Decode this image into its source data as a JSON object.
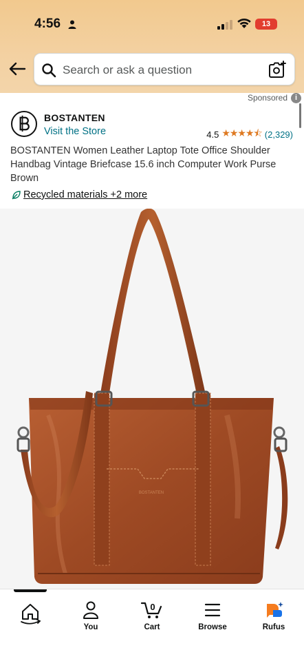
{
  "status_bar": {
    "time": "4:56",
    "battery": "13"
  },
  "search": {
    "placeholder": "Search or ask a question"
  },
  "sponsored_label": "Sponsored",
  "brand": {
    "name": "BOSTANTEN",
    "store_link": "Visit the Store",
    "rating": "4.5",
    "stars": "★★★★⯪",
    "review_count": "(2,329)"
  },
  "product": {
    "title": "BOSTANTEN Women Leather Laptop Tote Office Shoulder Handbag Vintage Briefcase 15.6 inch Computer Work Purse Brown",
    "recycled": "Recycled materials +2 more",
    "image_alt": "BOSTANTEN brown leather tote bag"
  },
  "bottom_nav": {
    "items": [
      {
        "label": "",
        "icon": "home-icon"
      },
      {
        "label": "You",
        "icon": "person-icon"
      },
      {
        "label": "Cart",
        "icon": "cart-icon",
        "badge": "0"
      },
      {
        "label": "Browse",
        "icon": "menu-icon"
      },
      {
        "label": "Rufus",
        "icon": "rufus-icon"
      }
    ]
  },
  "colors": {
    "header_bg": "#f2c98e",
    "link": "#007185",
    "star": "#de7921",
    "battery": "#e23d2f",
    "leather": "#a4502a"
  }
}
